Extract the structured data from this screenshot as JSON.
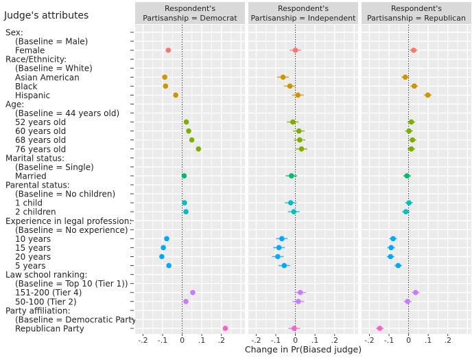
{
  "chart_data": {
    "type": "scatter",
    "subtype": "coefficient-plot-with-confidence-intervals",
    "y_title": "Judge's attributes",
    "xlabel": "Change in Pr(Biased judge)",
    "xlim": [
      -0.24,
      0.32
    ],
    "x_ticks": [
      -0.2,
      -0.1,
      0,
      0.1,
      0.2
    ],
    "x_tick_labels": [
      "-.2",
      "-.1",
      "0",
      ".1",
      ".2"
    ],
    "reference_line": 0,
    "grid": true,
    "categories": [
      "Sex:",
      "(Baseline = Male)",
      "Female",
      "Race/Ethnicity:",
      "(Baseline = White)",
      "Asian American",
      "Black",
      "Hispanic",
      "Age:",
      "(Baseline = 44 years old)",
      "52 years old",
      "60 years old",
      "68 years old",
      "76 years old",
      "Marital status:",
      "(Baseline = Single)",
      "Married",
      "Parental status:",
      "(Baseline = No children)",
      "1 child",
      "2 children",
      "Experience in legal profession:",
      "(Baseline = No experience)",
      "10 years",
      "15 years",
      "20 years",
      "5 years",
      "Law school ranking:",
      "(Baseline = Top 10 (Tier 1))",
      "151-200 (Tier 4)",
      "50-100 (Tier 2)",
      "Party affiliation:",
      "(Baseline = Democratic Party)",
      "Republican Party"
    ],
    "header_rows": [
      0,
      3,
      8,
      14,
      17,
      21,
      27,
      31
    ],
    "row_colors": [
      null,
      null,
      "#F8766D",
      null,
      null,
      "#CD9600",
      "#CD9600",
      "#CD9600",
      null,
      null,
      "#7CAE00",
      "#7CAE00",
      "#7CAE00",
      "#7CAE00",
      null,
      null,
      "#00BE67",
      null,
      null,
      "#00BFC4",
      "#00BFC4",
      null,
      null,
      "#00A9FF",
      "#00A9FF",
      "#00A9FF",
      "#00A9FF",
      null,
      null,
      "#C77CFF",
      "#C77CFF",
      null,
      null,
      "#FF61CC"
    ],
    "panels": [
      {
        "strip_line1": "Respondent's",
        "strip_line2": "Partisanship = Democrat",
        "ci_halfwidth": 0.01,
        "values": [
          null,
          null,
          -0.071,
          null,
          null,
          -0.089,
          -0.085,
          -0.033,
          null,
          null,
          0.021,
          0.033,
          0.049,
          0.083,
          null,
          null,
          0.01,
          null,
          null,
          0.012,
          0.019,
          null,
          null,
          -0.079,
          -0.096,
          -0.104,
          -0.068,
          null,
          null,
          0.054,
          0.019,
          null,
          null,
          0.22
        ]
      },
      {
        "strip_line1": "Respondent's",
        "strip_line2": "Partisanship = Independent",
        "ci_halfwidth": 0.03,
        "values": [
          null,
          null,
          0.0,
          null,
          null,
          -0.063,
          -0.028,
          0.013,
          null,
          null,
          -0.013,
          0.018,
          0.022,
          0.031,
          null,
          null,
          -0.02,
          null,
          null,
          -0.024,
          -0.008,
          null,
          null,
          -0.069,
          -0.084,
          -0.09,
          -0.057,
          null,
          null,
          0.025,
          0.015,
          null,
          null,
          -0.006
        ]
      },
      {
        "strip_line1": "Respondent's",
        "strip_line2": "Partisanship = Republican",
        "ci_halfwidth": 0.02,
        "values": [
          null,
          null,
          0.026,
          null,
          null,
          -0.017,
          0.029,
          0.098,
          null,
          null,
          0.014,
          0.002,
          0.02,
          0.014,
          null,
          null,
          -0.008,
          null,
          null,
          0.002,
          -0.014,
          null,
          null,
          -0.079,
          -0.089,
          -0.092,
          -0.053,
          null,
          null,
          0.036,
          -0.005,
          null,
          null,
          -0.147
        ]
      }
    ]
  }
}
